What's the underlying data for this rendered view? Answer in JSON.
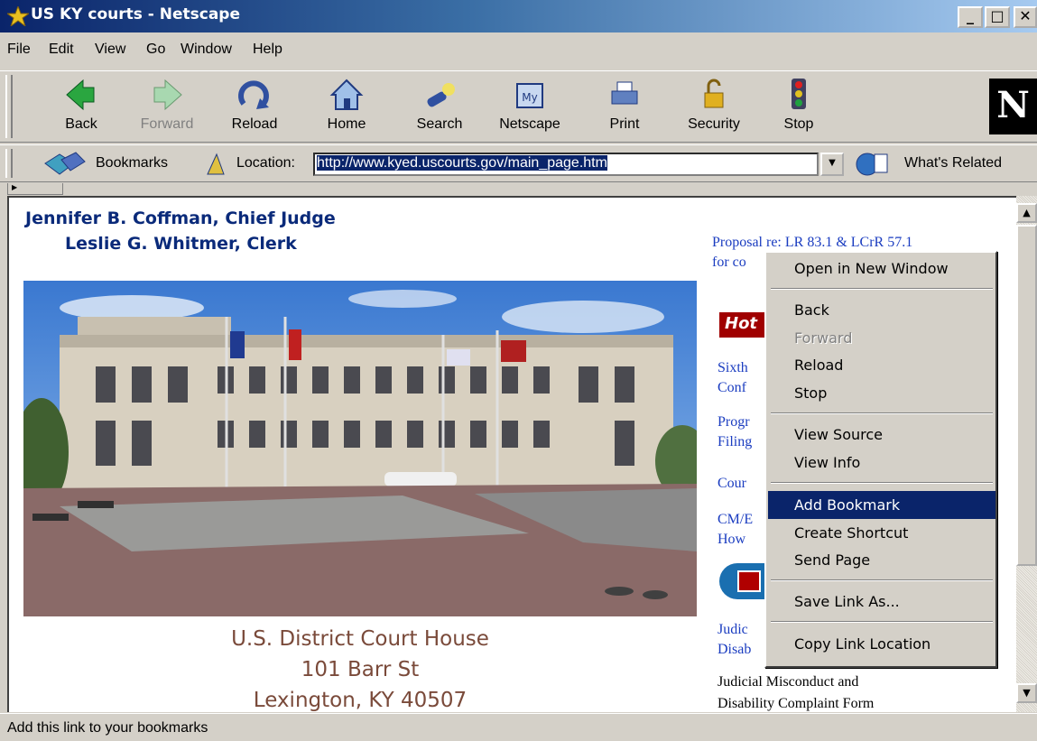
{
  "window": {
    "title": "US KY courts - Netscape",
    "btn_min": "_",
    "btn_max": "□",
    "btn_close": "✕"
  },
  "menubar": [
    "File",
    "Edit",
    "View",
    "Go",
    "Window",
    "Help"
  ],
  "toolbar": {
    "back": "Back",
    "forward": "Forward",
    "reload": "Reload",
    "home": "Home",
    "search": "Search",
    "netscape": "Netscape",
    "print": "Print",
    "security": "Security",
    "stop": "Stop",
    "logo": "N"
  },
  "location_bar": {
    "bookmarks": "Bookmarks",
    "location_label": "Location:",
    "url": "http://www.kyed.uscourts.gov/main_page.htm",
    "whats_related": "What's Related"
  },
  "page": {
    "chief_judge": "Jennifer B. Coffman, Chief Judge",
    "clerk": "Leslie G. Whitmer, Clerk",
    "caption_1": "U.S. District Court House",
    "caption_2": "101 Barr St",
    "caption_3": "Lexington, KY  40507",
    "links": {
      "proposal_1": "Proposal re: LR 83.1 & LCrR 57.1",
      "proposal_2": "for co",
      "hot": "Hot",
      "sixth_1": "Sixth",
      "sixth_2": "Conf",
      "prog_1": "Progr",
      "prog_2": "Filing",
      "cour": "Cour",
      "cmecf_1": "CM/E",
      "cmecf_2": "How",
      "judic_1": "Judic",
      "judic_2": "Disab"
    },
    "judicial_misconduct_1": "Judicial Misconduct and",
    "judicial_misconduct_2": "Disability Complaint Form"
  },
  "context_menu": {
    "open_new_window": "Open in New Window",
    "back": "Back",
    "forward": "Forward",
    "reload": "Reload",
    "stop": "Stop",
    "view_source": "View Source",
    "view_info": "View Info",
    "add_bookmark": "Add Bookmark",
    "create_shortcut": "Create Shortcut",
    "send_page": "Send Page",
    "save_link_as": "Save Link As...",
    "copy_link_location": "Copy Link Location"
  },
  "statusbar": {
    "text": "Add this link to your bookmarks"
  }
}
